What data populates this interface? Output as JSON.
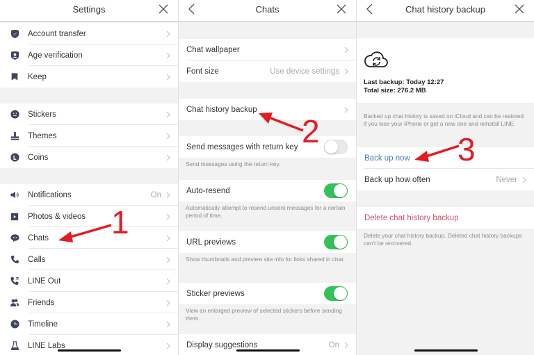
{
  "panels": {
    "settings": {
      "title": "Settings",
      "groups": [
        [
          {
            "label": "Account transfer",
            "icon": "shield-check-icon"
          },
          {
            "label": "Age verification",
            "icon": "id-shield-icon"
          },
          {
            "label": "Keep",
            "icon": "bookmark-icon"
          }
        ],
        [
          {
            "label": "Stickers",
            "icon": "smiley-icon"
          },
          {
            "label": "Themes",
            "icon": "brush-icon"
          },
          {
            "label": "Coins",
            "icon": "coin-icon"
          }
        ],
        [
          {
            "label": "Notifications",
            "icon": "speaker-icon",
            "value": "On"
          },
          {
            "label": "Photos & videos",
            "icon": "play-icon"
          },
          {
            "label": "Chats",
            "icon": "chat-bubble-icon"
          },
          {
            "label": "Calls",
            "icon": "phone-icon"
          },
          {
            "label": "LINE Out",
            "icon": "phone-out-icon"
          },
          {
            "label": "Friends",
            "icon": "friends-icon"
          },
          {
            "label": "Timeline",
            "icon": "clock-icon"
          },
          {
            "label": "LINE Labs",
            "icon": "flask-icon"
          }
        ]
      ],
      "annotation": "1"
    },
    "chats": {
      "title": "Chats",
      "chat_wallpaper": "Chat wallpaper",
      "font_size": {
        "label": "Font size",
        "value": "Use device settings"
      },
      "chat_history_backup": "Chat history backup",
      "send_return": {
        "label": "Send messages with return key",
        "on": false,
        "note": "Send messages using the return key."
      },
      "auto_resend": {
        "label": "Auto-resend",
        "on": true,
        "note": "Automatically attempt to resend unsent messages for a certain period of time."
      },
      "url_previews": {
        "label": "URL previews",
        "on": true,
        "note": "Show thumbnails and preview site info for links shared in chat."
      },
      "sticker_previews": {
        "label": "Sticker previews",
        "on": true,
        "note": "View an enlarged preview of selected stickers before sending them."
      },
      "display_suggestions": {
        "label": "Display suggestions",
        "value": "On"
      },
      "annotation": "2"
    },
    "backup": {
      "title": "Chat history backup",
      "last_backup": "Last backup: Today 12:27",
      "total_size": "Total size: 276.2 MB",
      "info_note": "Backed up chat history is saved on iCloud and can be restored if you lose your iPhone or get a new one and reinstall LINE.",
      "back_up_now": "Back up now",
      "back_up_often": {
        "label": "Back up how often",
        "value": "Never"
      },
      "delete": "Delete chat history backup",
      "delete_note": "Delete your chat history backup. Deleted chat history backups can't be recovered.",
      "annotation": "3"
    }
  },
  "colors": {
    "toggle_on": "#33c25a",
    "link_blue": "#4a7fbd",
    "danger_red": "#d0506e",
    "annotation_red": "#e31b23",
    "icon_navy": "#3d4560"
  }
}
